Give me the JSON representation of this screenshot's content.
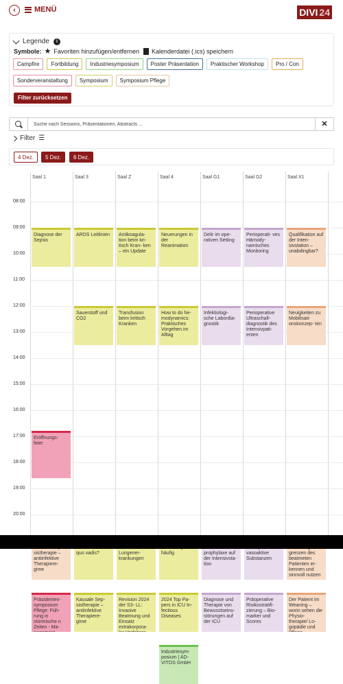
{
  "header": {
    "menu_label": "MENÜ",
    "logo_part1": "DIVI",
    "logo_part2": "24"
  },
  "legend": {
    "title": "Legende",
    "symbols_label": "Symbole:",
    "favorite_text": "Favoriten hinzufügen/entfernen",
    "calendar_text": "Kalenderdatei (.ics) speichern",
    "categories_row1": [
      {
        "label": "Campfire",
        "color": "#e59a9a"
      },
      {
        "label": "Fortbildung",
        "color": "#c6c64b"
      },
      {
        "label": "Industriesymposium",
        "color": "#8fcf86"
      },
      {
        "label": "Poster Präsentation",
        "color": "#4d6e9a"
      },
      {
        "label": "Praktischer Workshop",
        "color": "#bfe0e8"
      },
      {
        "label": "Pro / Con",
        "color": "#e0b050"
      }
    ],
    "categories_row2": [
      {
        "label": "Sonderveranstaltung",
        "color": "#e58aa6"
      },
      {
        "label": "Symposium",
        "color": "#cfcf6a"
      },
      {
        "label": "Symposium Pflege",
        "color": "#e8c6a8"
      }
    ],
    "reset_label": "Filter zurücksetzen"
  },
  "search": {
    "placeholder": "Suche nach Sessions, Präsentationen, Abstracts ..."
  },
  "filter": {
    "label": "Filter"
  },
  "days": [
    {
      "label": "4 Dez.",
      "selected": true
    },
    {
      "label": "5 Dez.",
      "selected": false
    },
    {
      "label": "6 Dez.",
      "selected": false
    }
  ],
  "rooms": [
    "Saal 1",
    "Saal 3",
    "Saal Z",
    "Saal 4",
    "Saal G1",
    "Saal G2",
    "Saal X1"
  ],
  "times": [
    "08:00",
    "09:00",
    "10:00",
    "11:00",
    "12:00",
    "13:00",
    "14:00",
    "15:00",
    "16:00",
    "17:00",
    "18:00",
    "19:00",
    "20:00"
  ],
  "events": [
    {
      "room": 0,
      "start": 8.5,
      "end": 9.25,
      "title": "Diagnose der Sepsis",
      "type": "fortbildung"
    },
    {
      "room": 0,
      "start": 12.4,
      "end": 13.3,
      "title": "Eröffnungs- feier",
      "type": "sonder"
    },
    {
      "room": 0,
      "start": 14.5,
      "end": 15.25,
      "title": "Kausale Sep- sistherapie – antiinfektive Therapiere- gime",
      "type": "pflege"
    },
    {
      "room": 0,
      "start": 15.5,
      "end": 16.25,
      "title": "Präsidenten- symposium Pflege: Füh- rung in stürmische n Zeiten - Ma- nagement",
      "type": "sonder"
    },
    {
      "room": 1,
      "start": 8.5,
      "end": 9.25,
      "title": "ARDS Leitlinien",
      "type": "fortbildung"
    },
    {
      "room": 1,
      "start": 10.0,
      "end": 10.75,
      "title": "Sauerstoff und CO2",
      "type": "fortbildung"
    },
    {
      "room": 1,
      "start": 14.5,
      "end": 15.25,
      "title": "VA-ECMO – quo vadis?",
      "type": "fortbildung"
    },
    {
      "room": 1,
      "start": 15.5,
      "end": 16.25,
      "title": "Kausale Sep- sistherapie – antiinfektive Therapiere- gime",
      "type": "fortbildung"
    },
    {
      "room": 2,
      "start": 8.5,
      "end": 9.25,
      "title": "Antikoagula- tion beim kri- tisch Kran- ken – ein Update",
      "type": "fortbildung"
    },
    {
      "room": 2,
      "start": 10.0,
      "end": 10.75,
      "title": "Transfusion beim kritisch Kranken",
      "type": "fortbildung"
    },
    {
      "room": 2,
      "start": 14.5,
      "end": 15.25,
      "title": "Obstruktive Lungener- krankungen",
      "type": "fortbildung"
    },
    {
      "room": 2,
      "start": 15.5,
      "end": 16.25,
      "title": "Revision 2024 der S3- LL: Invasive Beatmung und Einsatz extrakorpora- ler Verfahren",
      "type": "fortbildung"
    },
    {
      "room": 3,
      "start": 8.5,
      "end": 9.25,
      "title": "Neuerungen in der Reanimation",
      "type": "fortbildung"
    },
    {
      "room": 3,
      "start": 10.0,
      "end": 10.75,
      "title": "How to do he- modynamics: Praktisches Vorgehen im Alltag",
      "type": "fortbildung"
    },
    {
      "room": 3,
      "start": 14.5,
      "end": 15.25,
      "title": "Nicht sexy aber häufig",
      "type": "fortbildung"
    },
    {
      "room": 3,
      "start": 15.5,
      "end": 16.25,
      "title": "2024 Top Pa- pers in ICU In- fectious Diseases",
      "type": "fortbildung"
    },
    {
      "room": 3,
      "start": 16.5,
      "end": 17.25,
      "title": "Industriesym- posium | AD- VITOS GmbH",
      "type": "industrie"
    },
    {
      "room": 4,
      "start": 8.5,
      "end": 9.25,
      "title": "Delir im ope- rativen Setting",
      "type": "lila"
    },
    {
      "room": 4,
      "start": 10.0,
      "end": 10.75,
      "title": "Infektiologi- sche Labordia- gnostik",
      "type": "lila"
    },
    {
      "room": 4,
      "start": 14.5,
      "end": 15.25,
      "title": "Thrombose- prophylaxe auf der Intensivsta- tion",
      "type": "lila"
    },
    {
      "room": 4,
      "start": 15.5,
      "end": 16.25,
      "title": "Diagnose und Therapie von Bewusstseins- störungen auf der ICU",
      "type": "lila"
    },
    {
      "room": 5,
      "start": 8.5,
      "end": 9.25,
      "title": "Perioperati- ves Hämody- namisches Monitoring",
      "type": "lila"
    },
    {
      "room": 5,
      "start": 10.0,
      "end": 10.75,
      "title": "Perioperative Ultraschall- diagnostik des Intensivpati- enten",
      "type": "lila"
    },
    {
      "room": 5,
      "start": 14.5,
      "end": 15.25,
      "title": "Inotrope und vasoaktive Substanzen",
      "type": "lila"
    },
    {
      "room": 5,
      "start": 15.5,
      "end": 16.25,
      "title": "Präoperative Risikostratifi- zierung – Bio- marker und Scores",
      "type": "lila"
    },
    {
      "room": 6,
      "start": 8.5,
      "end": 9.25,
      "title": "Qualifikation auf der Inten- sivstation – unabdingbar?",
      "type": "pflege"
    },
    {
      "room": 6,
      "start": 10.0,
      "end": 10.75,
      "title": "Neuigkeiten zu Mobilisati- onskonzep- ten",
      "type": "pflege"
    },
    {
      "room": 6,
      "start": 14.5,
      "end": 15.25,
      "title": "Belastungs- grenzen des beatmeten Patienten er- kennen und sinnvoll nutzen",
      "type": "pflege"
    },
    {
      "room": 6,
      "start": 15.5,
      "end": 16.25,
      "title": "Der Patient im Weaning – worin sehen die Physio- therapie/ Lo- gopädie und Pflege",
      "type": "pflege"
    }
  ],
  "type_colors": {
    "fortbildung": {
      "bg": "#ecec9e",
      "border": "#c9c935"
    },
    "sonder": {
      "bg": "#f2a2b8",
      "border": "#d42a4b"
    },
    "pflege": {
      "bg": "#f7dcc7",
      "border": "#e7a57a"
    },
    "lila": {
      "bg": "#e9dced",
      "border": "#c3a6cc"
    },
    "industrie": {
      "bg": "#c7e9b6",
      "border": "#6cc34f"
    }
  }
}
